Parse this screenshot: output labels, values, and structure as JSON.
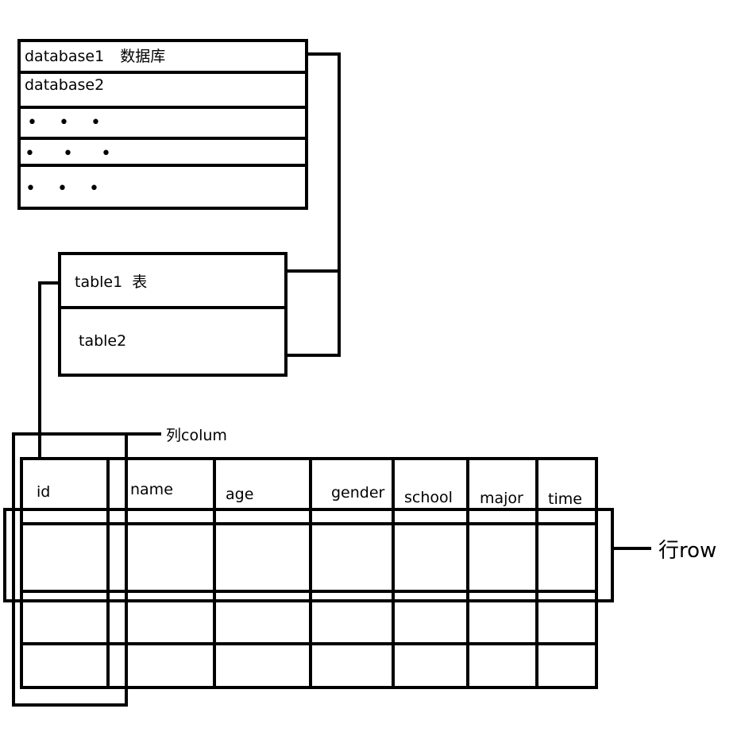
{
  "databases": {
    "db1_name": "database1",
    "db1_note": "数据库",
    "db2_name": "database2",
    "ellipsis_rows": [
      "• • •",
      "• • •",
      "• • •"
    ]
  },
  "tables": {
    "t1_name": "table1",
    "t1_note": "表",
    "t2_name": "table2"
  },
  "grid": {
    "column_label": "列colum",
    "row_label": "行row",
    "headers": [
      "id",
      "name",
      "age",
      "gender",
      "school",
      "major",
      "time"
    ]
  }
}
